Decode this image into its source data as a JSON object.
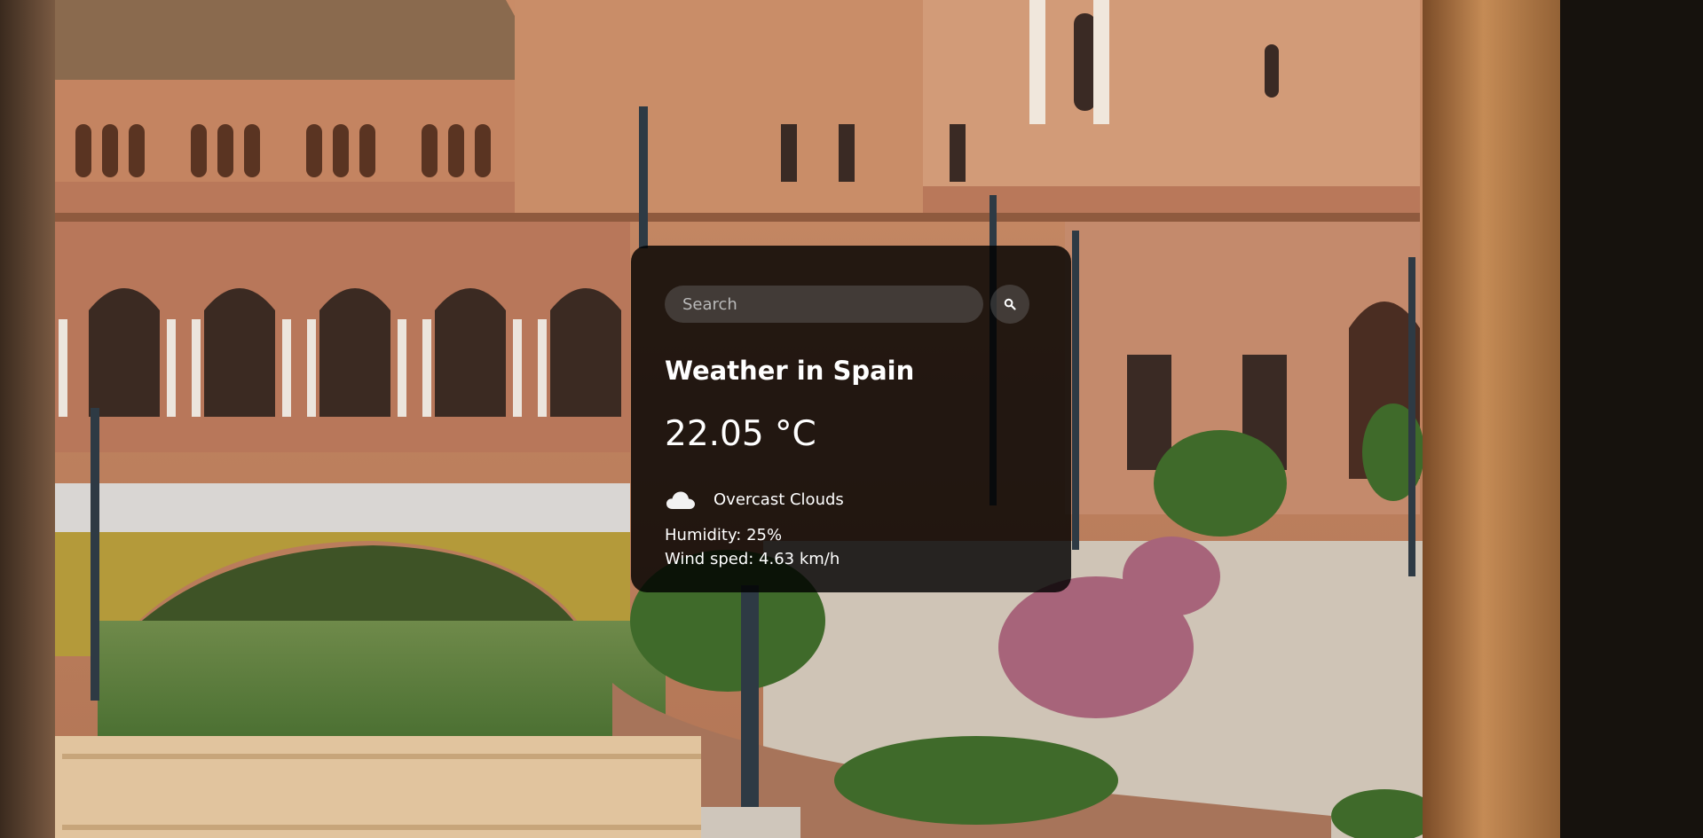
{
  "search": {
    "placeholder": "Search",
    "button_icon": "search-icon"
  },
  "weather": {
    "title": "Weather in Spain",
    "temperature": "22.05 °C",
    "icon": "cloud-icon",
    "description": "Overcast Clouds",
    "humidity": "Humidity: 25%",
    "wind": "Wind sped: 4.63 km/h"
  },
  "colors": {
    "card_background": "#000000",
    "text": "#ffffff",
    "input_background": "#7d7d7d"
  }
}
